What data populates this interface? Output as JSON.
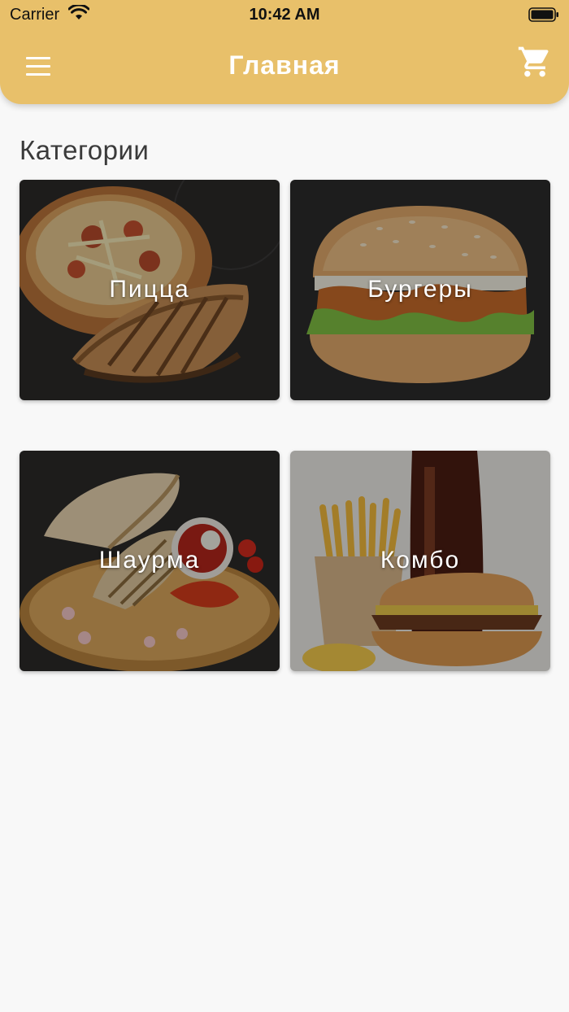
{
  "status_bar": {
    "carrier": "Carrier",
    "time": "10:42 AM"
  },
  "header": {
    "title": "Главная"
  },
  "icons": {
    "menu": "menu-icon",
    "cart": "cart-icon"
  },
  "colors": {
    "accent": "#e8c06a",
    "background": "#f8f8f8"
  },
  "main": {
    "section_title": "Категории",
    "categories": [
      {
        "label": "Пицца"
      },
      {
        "label": "Бургеры"
      },
      {
        "label": "Шаурма"
      },
      {
        "label": "Комбо"
      }
    ]
  }
}
